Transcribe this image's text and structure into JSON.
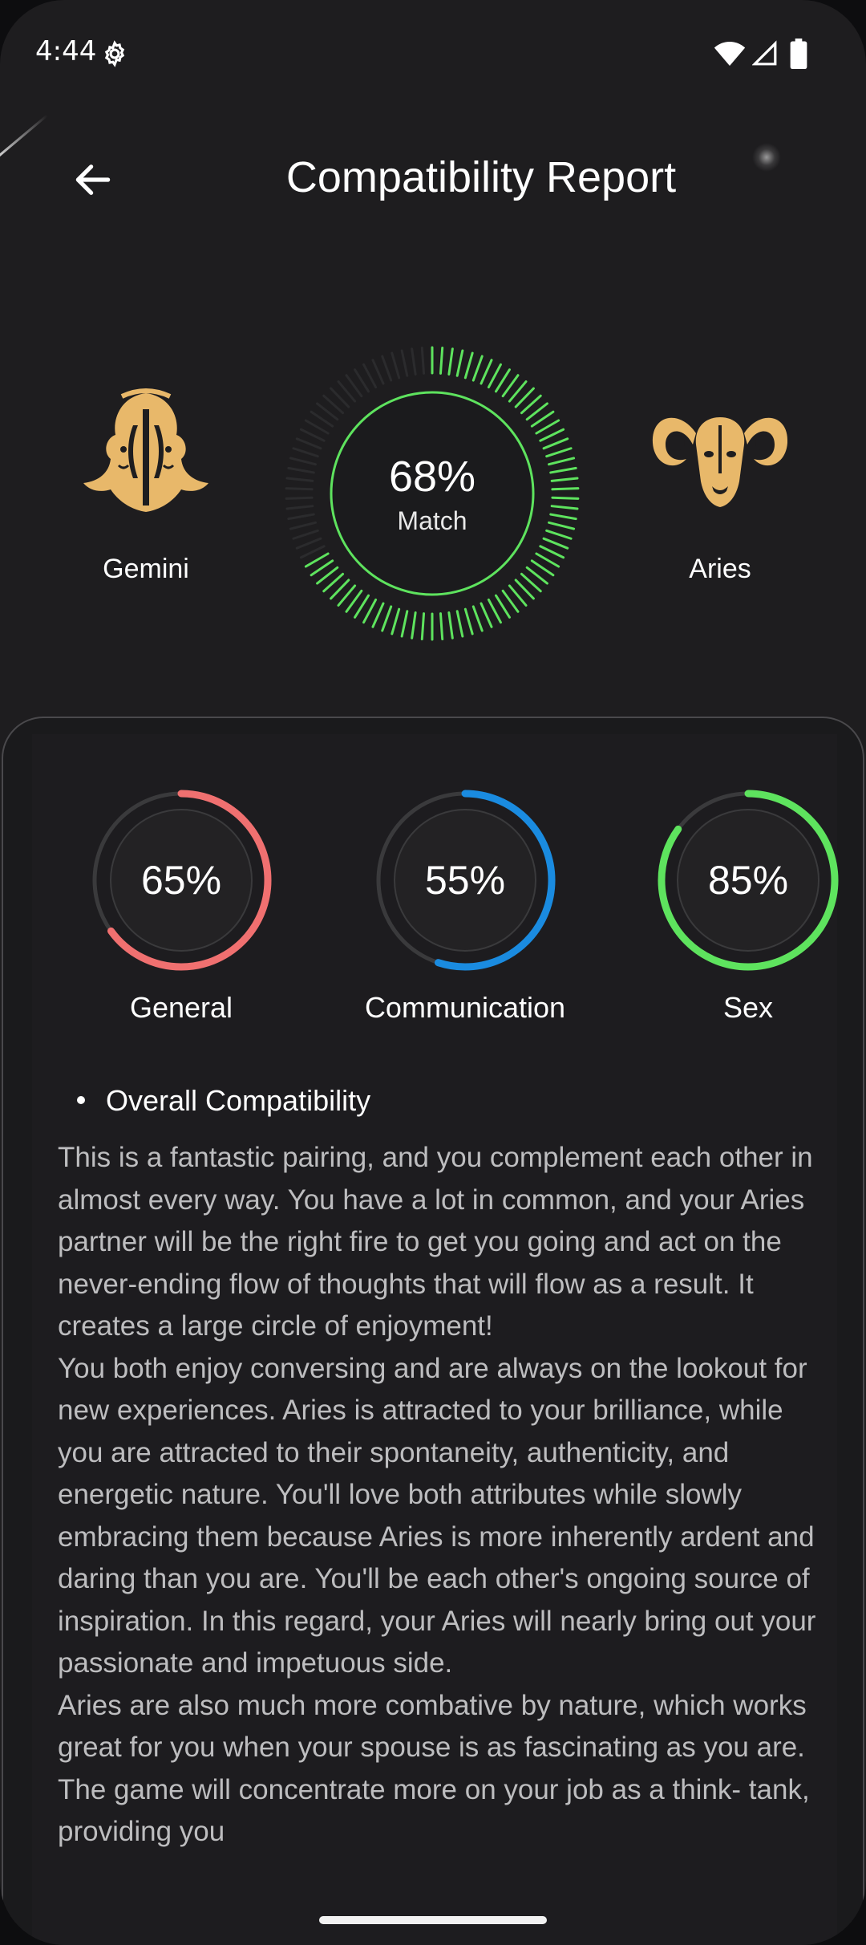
{
  "status_bar": {
    "time": "4:44",
    "icons": [
      "gear-icon",
      "wifi-icon",
      "signal-icon",
      "battery-icon"
    ]
  },
  "header": {
    "title": "Compatibility Report",
    "back_icon": "arrow-left-icon"
  },
  "signs": {
    "left": {
      "name": "Gemini",
      "icon": "gemini-icon"
    },
    "right": {
      "name": "Aries",
      "icon": "aries-icon"
    }
  },
  "match": {
    "percent_text": "68%",
    "label": "Match",
    "value": 0.68
  },
  "metrics": [
    {
      "label": "General",
      "percent_text": "65%",
      "value": 0.65,
      "color": "#f07070"
    },
    {
      "label": "Communication",
      "percent_text": "55%",
      "value": 0.55,
      "color": "#1a8be0"
    },
    {
      "label": "Sex",
      "percent_text": "85%",
      "value": 0.85,
      "color": "#5ee35e"
    }
  ],
  "colors": {
    "background": "#1e1d1f",
    "card": "#1d1c1f",
    "gauge_green": "#5ee35e",
    "sign_gold": "#e8b86a",
    "body_text": "#bdbdbf"
  },
  "section": {
    "heading": "Overall Compatibility",
    "paragraphs": [
      "This is a fantastic pairing, and you complement each other in almost every way. You have a lot in common, and your Aries partner will be the right fire to get you going and act on the never-ending flow of thoughts that will flow as a result. It creates a large circle of enjoyment!",
      "You both enjoy conversing and are always on the lookout for new experiences. Aries is attracted to your brilliance, while you are attracted to their spontaneity, authenticity, and energetic nature. You'll love both attributes while slowly embracing them because Aries is more inherently ardent and daring than you are. You'll be each other's ongoing source of inspiration. In this regard, your Aries will nearly bring out your passionate and impetuous side.",
      "Aries are also much more combative by nature, which works great for you when your spouse is as fascinating as you are. The game will concentrate more on your job as a think- tank, providing you"
    ]
  }
}
